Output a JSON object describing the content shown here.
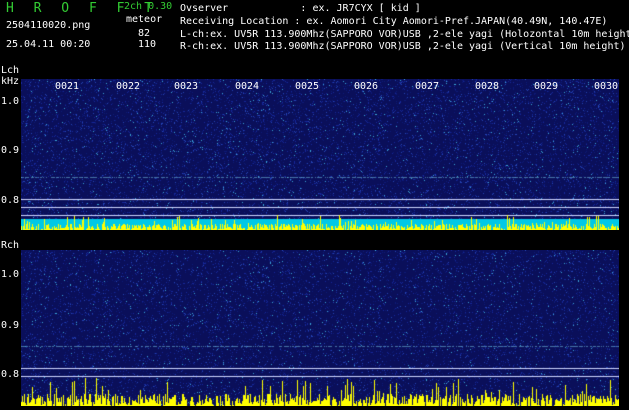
{
  "header": {
    "title": "H R O F F T",
    "mode": "2ch 0.30",
    "mode_label": "meteor",
    "l_count": "82",
    "r_count": "110",
    "filename": "2504110020.png",
    "timestamp": "25.04.11 00:20",
    "observer": "Ovserver            : ex. JR7CYX [ kid ]",
    "location": "Receiving Location : ex. Aomori City Aomori-Pref.JAPAN(40.49N, 140.47E)",
    "lch_info": "L-ch:ex. UV5R 113.900Mhz(SAPPORO VOR)USB ,2-ele yagi (Holozontal 10m height)",
    "rch_info": "R-ch:ex. UV5R 113.900Mhz(SAPPORO VOR)USB ,2-ele yagi (Vertical 10m height)"
  },
  "lch_panel": {
    "label": "Lch",
    "unit": "kHz",
    "yticks": [
      "1.0",
      "0.9",
      "0.8"
    ],
    "time_labels": [
      "0021",
      "0022",
      "0023",
      "0024",
      "0025",
      "0026",
      "0027",
      "0028",
      "0029",
      "0030"
    ]
  },
  "rch_panel": {
    "label": "Rch",
    "yticks": [
      "1.0",
      "0.9",
      "0.8"
    ]
  },
  "colors": {
    "background": "#000000",
    "panel_bg": "#0a0f5a",
    "text_green": "#33cc33",
    "text_white": "#ffffff",
    "cyan_band": "#00c8e6",
    "yellow_bars": "#ffff00"
  }
}
